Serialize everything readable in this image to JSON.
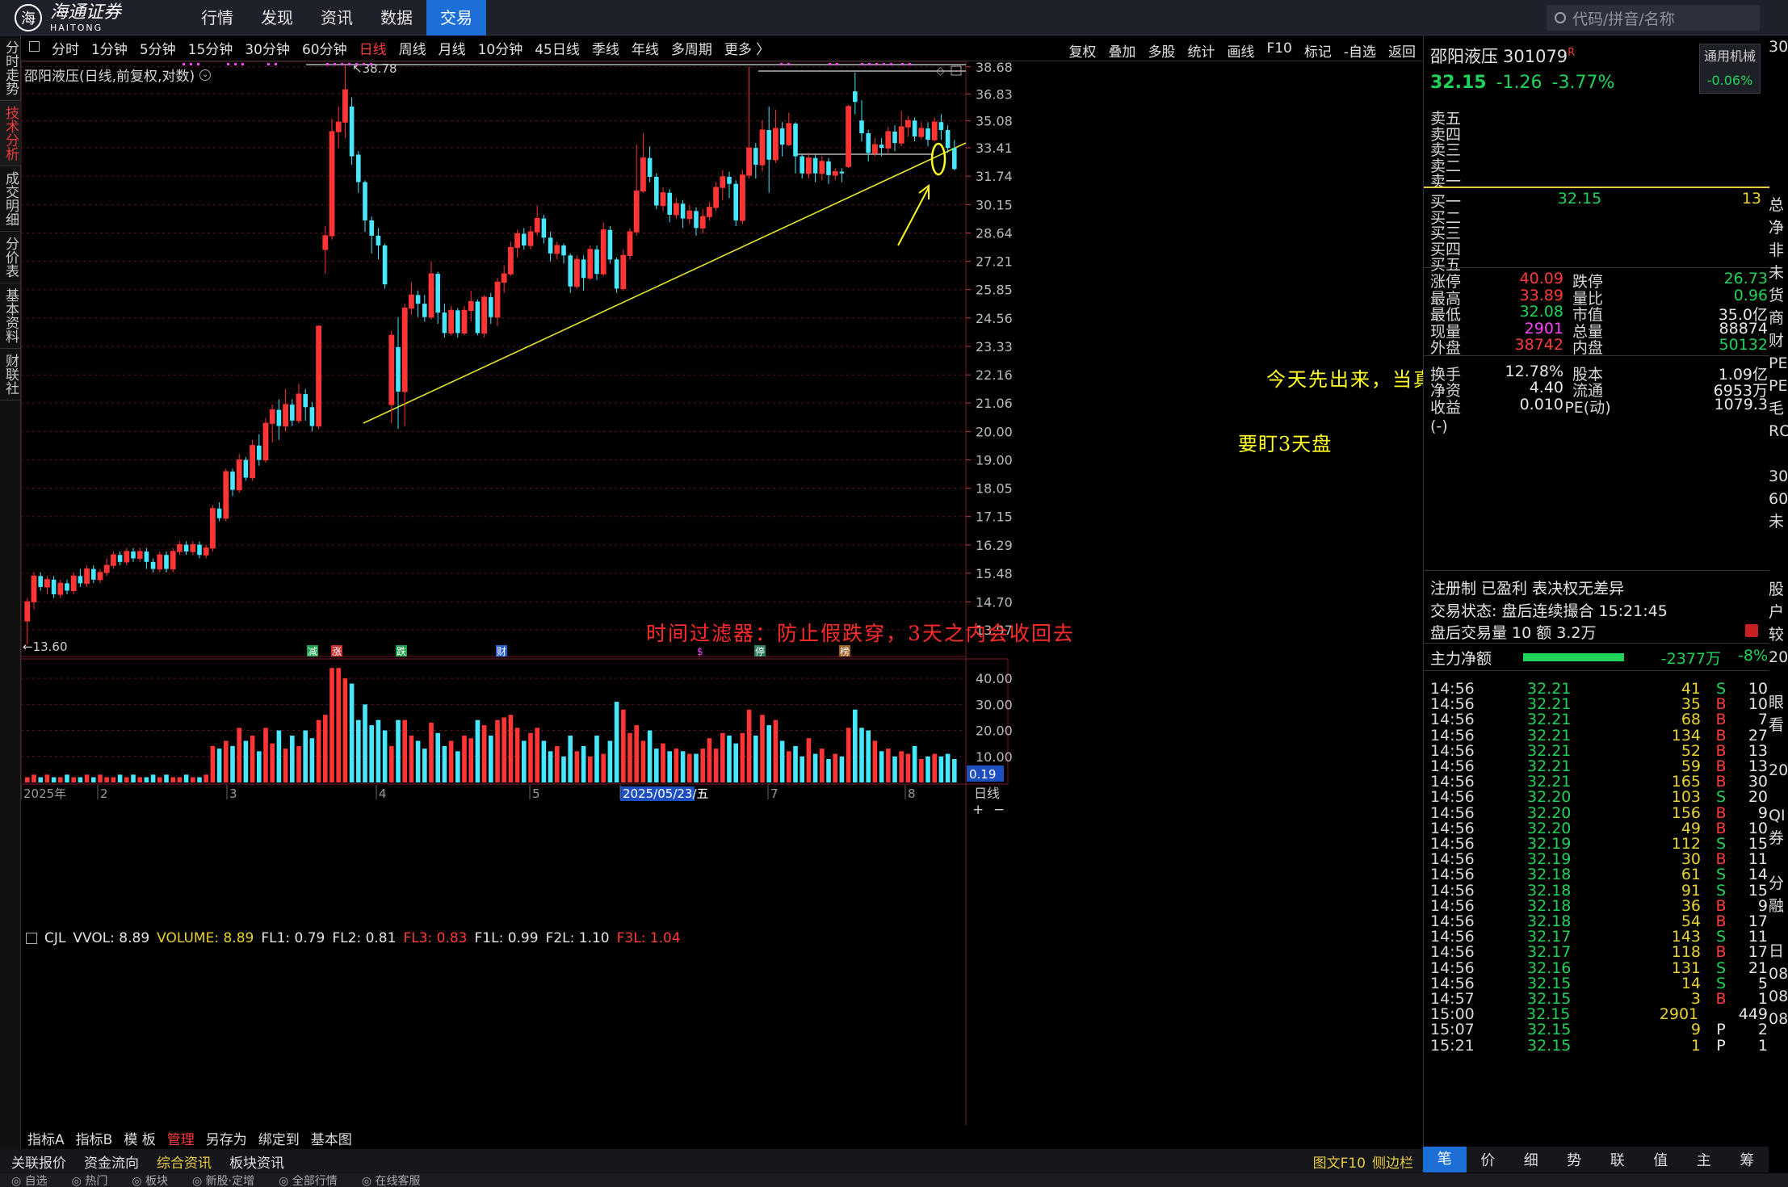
{
  "nav": {
    "brand_cn": "海通证券",
    "brand_en": "HAITONG",
    "brand_mark": "海",
    "items": [
      "行情",
      "发现",
      "资讯",
      "数据",
      "交易"
    ],
    "active": "交易",
    "search_placeholder": "代码/拼音/名称"
  },
  "side_tabs": [
    "分时走势",
    "技术分析",
    "成交明细",
    "分价表",
    "基本资料",
    "财联社"
  ],
  "toolbar": {
    "periods": [
      "分时",
      "1分钟",
      "5分钟",
      "15分钟",
      "30分钟",
      "60分钟",
      "日线",
      "周线",
      "月线",
      "10分钟",
      "45日线",
      "季线",
      "年线",
      "多周期",
      "更多 〉"
    ],
    "active": "日线",
    "tools": [
      "复权",
      "叠加",
      "多股",
      "统计",
      "画线",
      "F10",
      "标记",
      "-自选",
      "返回"
    ]
  },
  "chart": {
    "title": "邵阳液压(日线,前复权,对数)",
    "y_ticks": [
      "38.68",
      "36.83",
      "35.08",
      "33.41",
      "31.74",
      "30.15",
      "28.64",
      "27.21",
      "25.85",
      "24.56",
      "23.33",
      "22.16",
      "21.06",
      "20.00",
      "19.00",
      "18.05",
      "17.15",
      "16.29",
      "15.48",
      "14.70",
      "13.97"
    ],
    "max_label": "38.78",
    "min_label": "13.60",
    "event_markers": [
      "减",
      "涨",
      "跌",
      "财",
      "$",
      "停",
      "榜"
    ],
    "annotations": {
      "red": "时间过滤器：防止假跌穿，3天之内会收回去",
      "yellow_1": "今天先出来，当真跌穿对待",
      "yellow_2": "要盯3天盘"
    },
    "colors": {
      "up": "#ff3535",
      "down": "#47e8ff",
      "trend": "#e5e52a",
      "ann_red": "#ff2b2b",
      "ann_yellow": "#ffff22"
    }
  },
  "volume": {
    "label_name": "CJL",
    "vvol": "VVOL: 8.89",
    "volume": "VOLUME: 8.89",
    "fl1": "FL1: 0.79",
    "fl2": "FL2: 0.81",
    "fl3": "FL3: 0.83",
    "f1l": "F1L: 0.99",
    "f2l": "F2L: 1.10",
    "f3l": "F3L: 1.04",
    "y_ticks": [
      "40.00",
      "30.00",
      "20.00",
      "10.00"
    ],
    "current": "0.19"
  },
  "xaxis": {
    "labels": [
      "2025年",
      "2",
      "3",
      "4",
      "5",
      "2025/05/23/五",
      "7",
      "8"
    ],
    "period": "日线"
  },
  "bottom_tabs": [
    "指标A",
    "指标B",
    "模 板",
    "管理",
    "另存为",
    "绑定到",
    "基本图"
  ],
  "bottom_active": "管理",
  "tabbar2": [
    "关联报价",
    "资金流向",
    "综合资讯",
    "板块资讯"
  ],
  "tabbar2_right": [
    "图文F10",
    "侧边栏"
  ],
  "statusbar": [
    "自选",
    "热门",
    "板块",
    "新股·定增",
    "全部行情",
    "在线客服"
  ],
  "stock": {
    "name": "邵阳液压",
    "code": "301079",
    "badge": "R",
    "price": "32.15",
    "change": "-1.26",
    "pct": "-3.77%",
    "tag": "通用机械",
    "tag_pct": "-0.06%"
  },
  "orderbook": {
    "asks": [
      "卖五",
      "卖四",
      "卖三",
      "卖二",
      "卖一"
    ],
    "bids": [
      {
        "l": "买一",
        "p": "32.15",
        "q": "13"
      },
      {
        "l": "买二",
        "p": "",
        "q": ""
      },
      {
        "l": "买三",
        "p": "",
        "q": ""
      },
      {
        "l": "买四",
        "p": "",
        "q": ""
      },
      {
        "l": "买五",
        "p": "",
        "q": ""
      }
    ]
  },
  "stats": [
    {
      "a": "涨停",
      "b": "40.09",
      "c": "跌停",
      "d": "26.73"
    },
    {
      "a": "最高",
      "b": "33.89",
      "c": "量比",
      "d": "0.96"
    },
    {
      "a": "最低",
      "b": "32.08",
      "c": "市值",
      "d": "35.0亿"
    },
    {
      "a": "现量",
      "b": "2901",
      "c": "总量",
      "d": "88874"
    },
    {
      "a": "外盘",
      "b": "38742",
      "c": "内盘",
      "d": "50132"
    },
    {
      "a": "换手",
      "b": "12.78%",
      "c": "股本",
      "d": "1.09亿"
    },
    {
      "a": "净资",
      "b": "4.40",
      "c": "流通",
      "d": "6953万"
    },
    {
      "a": "收益(-)",
      "b": "0.010",
      "c": "PE(动)",
      "d": "1079.3"
    }
  ],
  "info": {
    "reg": "注册制 已盈利 表决权无差异",
    "state": "交易状态: 盘后连续撮合 15:21:45",
    "after": "盘后交易量 10 额 3.2万",
    "flow_label": "主力净额",
    "flow_val": "-2377万",
    "flow_pct": "-8%"
  },
  "trades": [
    {
      "t": "14:56",
      "p": "32.21",
      "v": "41",
      "s": "S",
      "n": "10"
    },
    {
      "t": "14:56",
      "p": "32.21",
      "v": "35",
      "s": "B",
      "n": "10"
    },
    {
      "t": "14:56",
      "p": "32.21",
      "v": "68",
      "s": "B",
      "n": "7"
    },
    {
      "t": "14:56",
      "p": "32.21",
      "v": "134",
      "s": "B",
      "n": "27"
    },
    {
      "t": "14:56",
      "p": "32.21",
      "v": "52",
      "s": "B",
      "n": "13"
    },
    {
      "t": "14:56",
      "p": "32.21",
      "v": "59",
      "s": "B",
      "n": "13"
    },
    {
      "t": "14:56",
      "p": "32.21",
      "v": "165",
      "s": "B",
      "n": "30"
    },
    {
      "t": "14:56",
      "p": "32.20",
      "v": "103",
      "s": "S",
      "n": "20"
    },
    {
      "t": "14:56",
      "p": "32.20",
      "v": "156",
      "s": "B",
      "n": "9"
    },
    {
      "t": "14:56",
      "p": "32.20",
      "v": "49",
      "s": "B",
      "n": "10"
    },
    {
      "t": "14:56",
      "p": "32.19",
      "v": "112",
      "s": "S",
      "n": "15"
    },
    {
      "t": "14:56",
      "p": "32.19",
      "v": "30",
      "s": "B",
      "n": "11"
    },
    {
      "t": "14:56",
      "p": "32.18",
      "v": "61",
      "s": "S",
      "n": "14"
    },
    {
      "t": "14:56",
      "p": "32.18",
      "v": "91",
      "s": "S",
      "n": "15"
    },
    {
      "t": "14:56",
      "p": "32.18",
      "v": "36",
      "s": "B",
      "n": "9"
    },
    {
      "t": "14:56",
      "p": "32.18",
      "v": "54",
      "s": "B",
      "n": "17"
    },
    {
      "t": "14:56",
      "p": "32.17",
      "v": "143",
      "s": "S",
      "n": "11"
    },
    {
      "t": "14:56",
      "p": "32.17",
      "v": "118",
      "s": "B",
      "n": "17"
    },
    {
      "t": "14:56",
      "p": "32.16",
      "v": "131",
      "s": "S",
      "n": "21"
    },
    {
      "t": "14:56",
      "p": "32.15",
      "v": "14",
      "s": "S",
      "n": "5"
    },
    {
      "t": "14:57",
      "p": "32.15",
      "v": "3",
      "s": "B",
      "n": "1"
    },
    {
      "t": "15:00",
      "p": "32.15",
      "v": "2901",
      "s": "",
      "n": "449"
    },
    {
      "t": "15:07",
      "p": "32.15",
      "v": "9",
      "s": "P",
      "n": "2"
    },
    {
      "t": "15:21",
      "p": "32.15",
      "v": "1",
      "s": "P",
      "n": "1"
    }
  ],
  "rp_tabs": [
    "笔",
    "价",
    "细",
    "势",
    "联",
    "值",
    "主",
    "筹"
  ],
  "rp_active": "笔",
  "far_right": [
    "30",
    "",
    "",
    "",
    "",
    "",
    "",
    "总",
    "净",
    "非",
    "未",
    "货",
    "商",
    "财",
    "PE",
    "PE",
    "毛",
    "RO",
    "",
    "30",
    "60",
    "未",
    "",
    "",
    "股",
    "户",
    "较",
    "20",
    "",
    "眼",
    "看",
    "",
    "20",
    "",
    "QI",
    "券",
    "",
    "分",
    "融",
    "",
    "日",
    "08",
    "08",
    "08"
  ]
}
